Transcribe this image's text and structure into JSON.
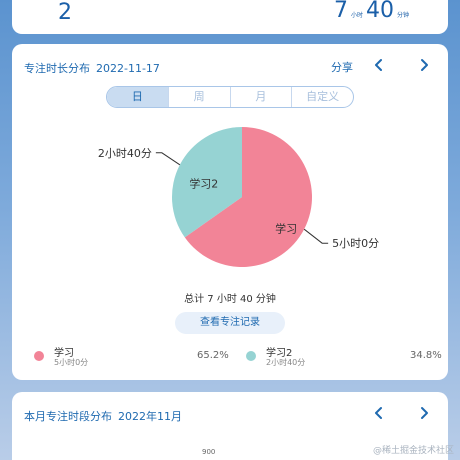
{
  "top": {
    "left_value": "2",
    "hours": "7",
    "hours_unit": "小时",
    "minutes": "40",
    "minutes_unit": "分钟"
  },
  "focus_dist": {
    "title": "专注时长分布",
    "date": "2022-11-17",
    "share_label": "分享",
    "tabs": [
      "日",
      "周",
      "月",
      "自定义"
    ],
    "active_tab": "日",
    "total_label": "总计 7 小时 40 分钟",
    "view_records_label": "查看专注记录",
    "chart_data": {
      "type": "pie",
      "slices": [
        {
          "name": "学习",
          "value": 300,
          "duration_label": "5小时0分",
          "percent_label": "65.2%",
          "color": "#f28497"
        },
        {
          "name": "学习2",
          "value": 160,
          "duration_label": "2小时40分",
          "percent_label": "34.8%",
          "color": "#96d3d3"
        }
      ]
    }
  },
  "monthly": {
    "title": "本月专注时段分布",
    "month": "2022年11月",
    "y_tick": "900"
  },
  "watermark": "@稀土掘金技术社区",
  "colors": {
    "accent": "#1f6ab0",
    "pie_study": "#f28497",
    "pie_study2": "#96d3d3"
  }
}
